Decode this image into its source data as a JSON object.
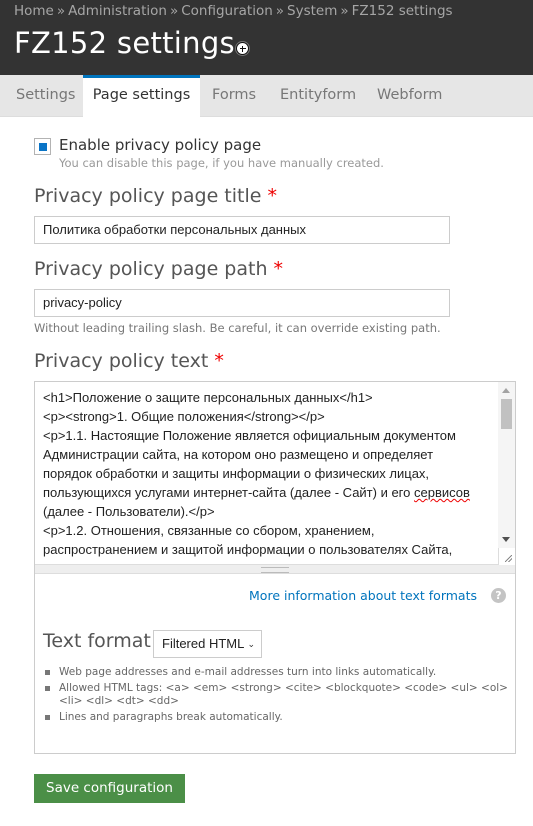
{
  "breadcrumb": [
    {
      "label": "Home"
    },
    {
      "label": "Administration"
    },
    {
      "label": "Configuration"
    },
    {
      "label": "System"
    },
    {
      "label": "FZ152 settings"
    }
  ],
  "breadcrumb_separator": "»",
  "page_title": "FZ152 settings",
  "shortcut_icon": "add-to-shortcuts-icon",
  "tabs": [
    {
      "label": "Settings",
      "active": false
    },
    {
      "label": "Page settings",
      "active": true
    },
    {
      "label": "Forms",
      "active": false
    },
    {
      "label": "Entityform",
      "active": false
    },
    {
      "label": "Webform",
      "active": false
    }
  ],
  "form": {
    "enable_checkbox": {
      "label": "Enable privacy policy page",
      "checked": true,
      "description": "You can disable this page, if you have manually created."
    },
    "required_marker": "*",
    "page_title_field": {
      "label": "Privacy policy page title",
      "value": "Политика обработки персональных данных"
    },
    "page_path_field": {
      "label": "Privacy policy page path",
      "value": "privacy-policy",
      "description": "Without leading trailing slash. Be careful, it can override existing path."
    },
    "text_field": {
      "label": "Privacy policy text",
      "lines": [
        "<h1>Положение о защите персональных данных</h1>",
        "<p><strong>1. Общие положения</strong></p>",
        "<p>1.1. Настоящие Положение является официальным документом",
        "Администрации сайта, на котором оно размещено и определяет",
        "порядок обработки и защиты информации о физических лицах,",
        "пользующихся услугами интернет-сайта (далее - Сайт) и его ",
        "(далее - Пользователи).</p>",
        "<p>1.2. Отношения, связанные со сбором, хранением,",
        "распространением и защитой информации о пользователях Сайта,"
      ],
      "misspelled_word": "сервисов"
    },
    "more_info_link": "More information about text formats",
    "help_icon": "?",
    "text_format": {
      "label": "Text format",
      "selected": "Filtered HTML",
      "tips": [
        "Web page addresses and e-mail addresses turn into links automatically.",
        "Allowed HTML tags: <a> <em> <strong> <cite> <blockquote> <code> <ul> <ol> <li> <dl> <dt> <dd>",
        "Lines and paragraphs break automatically."
      ]
    },
    "save_label": "Save configuration"
  },
  "colors": {
    "header_bg": "#333333",
    "tab_active_accent": "#0074bd",
    "link": "#0074bd",
    "checkbox_fill": "#0a74c6",
    "required": "#ee0000",
    "save_button": "#4b8f47"
  }
}
